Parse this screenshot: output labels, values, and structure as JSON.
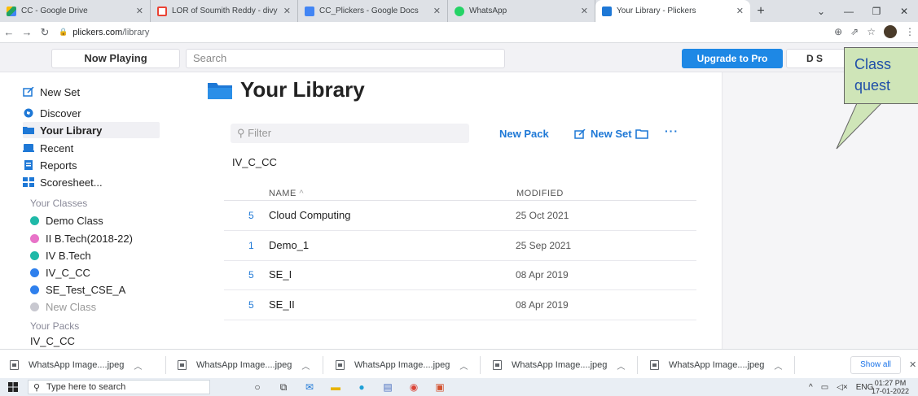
{
  "browser": {
    "tabs": [
      {
        "title": "CC - Google Drive",
        "icon": "google-drive-icon",
        "color": "#1fa463"
      },
      {
        "title": "LOR of Soumith Reddy - divy",
        "icon": "gmail-icon",
        "color": "#ea4335"
      },
      {
        "title": "CC_Plickers - Google Docs",
        "icon": "google-docs-icon",
        "color": "#4285f4"
      },
      {
        "title": "WhatsApp",
        "icon": "whatsapp-icon",
        "color": "#25d366"
      },
      {
        "title": "Your Library - Plickers",
        "icon": "plickers-icon",
        "color": "#1e78d6"
      }
    ],
    "url_host": "plickers.com",
    "url_path": "/library"
  },
  "topbar": {
    "now_playing": "Now Playing",
    "search_placeholder": "Search",
    "upgrade": "Upgrade to Pro",
    "user_initials": "D S"
  },
  "sidebar": {
    "nav": [
      {
        "label": "New Set",
        "icon": "new-set-icon"
      },
      {
        "label": "Discover",
        "icon": "discover-icon"
      },
      {
        "label": "Your Library",
        "icon": "folder-icon"
      },
      {
        "label": "Recent",
        "icon": "recent-icon"
      },
      {
        "label": "Reports",
        "icon": "reports-icon"
      },
      {
        "label": "Scoresheet...",
        "icon": "scoresheet-icon"
      }
    ],
    "classes_heading": "Your Classes",
    "classes": [
      {
        "label": "Demo Class",
        "color": "#1fb9a8"
      },
      {
        "label": "II B.Tech(2018-22)",
        "color": "#e873c8"
      },
      {
        "label": "IV B.Tech",
        "color": "#1fb9a8"
      },
      {
        "label": "IV_C_CC",
        "color": "#2f80ed"
      },
      {
        "label": "SE_Test_CSE_A",
        "color": "#2f80ed"
      }
    ],
    "new_class": "New Class",
    "packs_heading": "Your Packs",
    "packs": [
      "IV_C_CC"
    ]
  },
  "main": {
    "title": "Your Library",
    "filter_placeholder": "Filter",
    "new_pack": "New Pack",
    "new_set": "New Set",
    "more": "···",
    "crumb": "IV_C_CC",
    "col_name": "NAME",
    "col_name_sort": "^",
    "col_modified": "MODIFIED",
    "rows": [
      {
        "count": "5",
        "name": "Cloud Computing",
        "modified": "25 Oct 2021"
      },
      {
        "count": "1",
        "name": "Demo_1",
        "modified": "25 Sep 2021"
      },
      {
        "count": "5",
        "name": "SE_I",
        "modified": "08 Apr 2019"
      },
      {
        "count": "5",
        "name": "SE_II",
        "modified": "08 Apr 2019"
      }
    ]
  },
  "callout": {
    "line1": "Class",
    "line2": "quest"
  },
  "downloads": {
    "items": [
      "WhatsApp Image....jpeg",
      "WhatsApp Image....jpeg",
      "WhatsApp Image....jpeg",
      "WhatsApp Image....jpeg",
      "WhatsApp Image....jpeg"
    ],
    "show_all": "Show all"
  },
  "taskbar": {
    "search_placeholder": "Type here to search",
    "lang": "ENG",
    "time": "01:27 PM",
    "date": "17-01-2022"
  }
}
